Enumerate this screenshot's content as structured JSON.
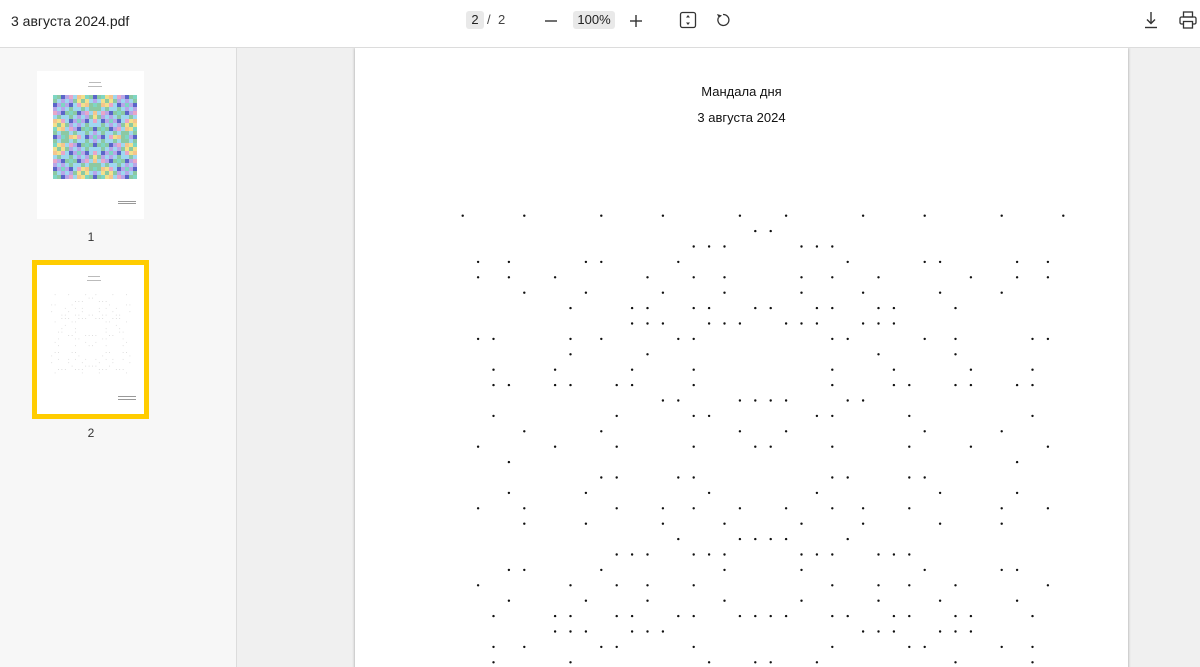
{
  "toolbar": {
    "title": "3 августа 2024.pdf",
    "page_current": "2",
    "page_separator": "/",
    "page_total": "2",
    "zoom": "100%",
    "icons": [
      "minus-icon",
      "plus-icon",
      "fit-page-icon",
      "rotate-icon",
      "download-icon",
      "print-icon"
    ]
  },
  "sidebar": {
    "thumbnails": [
      {
        "label": "1",
        "selected": false
      },
      {
        "label": "2",
        "selected": true
      }
    ]
  },
  "document": {
    "heading": "Мандала дня",
    "date": "3 августа 2024"
  },
  "colors": {
    "selection": "#ffcc00",
    "toolbar_bg": "#ffffff",
    "viewer_bg": "#f0f0f0"
  }
}
